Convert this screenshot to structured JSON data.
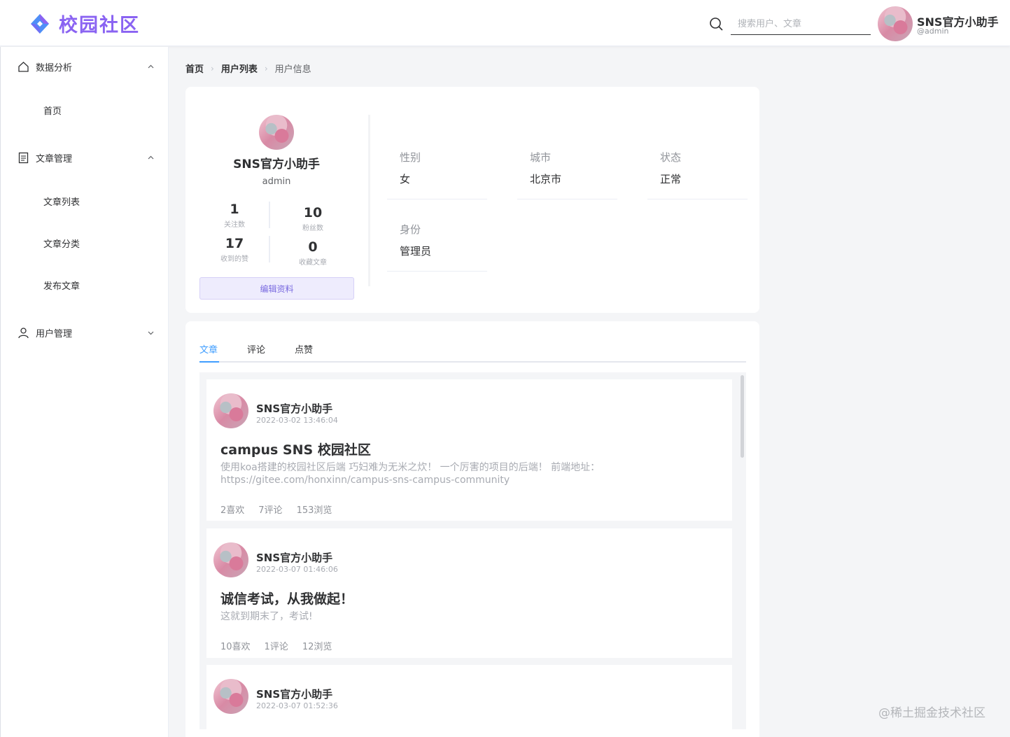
{
  "header": {
    "logo_text": "校园社区",
    "search_placeholder": "搜索用户、文章",
    "user_name": "SNS官方小助手",
    "user_handle": "@admin"
  },
  "sidebar": {
    "groups": [
      {
        "label": "数据分析",
        "icon": "home-icon",
        "expanded": true,
        "items": [
          "首页"
        ]
      },
      {
        "label": "文章管理",
        "icon": "document-icon",
        "expanded": true,
        "items": [
          "文章列表",
          "文章分类",
          "发布文章"
        ]
      },
      {
        "label": "用户管理",
        "icon": "user-icon",
        "expanded": false,
        "items": []
      }
    ]
  },
  "breadcrumb": {
    "home": "首页",
    "user_list": "用户列表",
    "current": "用户信息"
  },
  "profile": {
    "name": "SNS官方小助手",
    "handle": "admin",
    "stats": {
      "following": {
        "value": "1",
        "label": "关注数"
      },
      "fans": {
        "value": "10",
        "label": "粉丝数"
      },
      "likes_received": {
        "value": "17",
        "label": "收到的赞"
      },
      "favorites": {
        "value": "0",
        "label": "收藏文章"
      }
    },
    "edit_label": "编辑资料",
    "info": {
      "gender": {
        "key": "性别",
        "value": "女"
      },
      "city": {
        "key": "城市",
        "value": "北京市"
      },
      "status": {
        "key": "状态",
        "value": "正常"
      },
      "role": {
        "key": "身份",
        "value": "管理员"
      }
    }
  },
  "tabs": {
    "articles": "文章",
    "comments": "评论",
    "likes": "点赞",
    "active": "articles"
  },
  "posts": [
    {
      "author": "SNS官方小助手",
      "time": "2022-03-02 13:46:04",
      "title": "campus SNS 校园社区",
      "excerpt": "使用koa搭建的校园社区后端 巧妇难为无米之炊！ 一个厉害的项目的后端！ 前端地址：https://gitee.com/honxinn/campus-sns-campus-community",
      "likes": "2喜欢",
      "comments": "7评论",
      "views": "153浏览"
    },
    {
      "author": "SNS官方小助手",
      "time": "2022-03-07 01:46:06",
      "title": "诚信考试，从我做起！",
      "excerpt": "这就到期末了，考试!",
      "likes": "10喜欢",
      "comments": "1评论",
      "views": "12浏览"
    },
    {
      "author": "SNS官方小助手",
      "time": "2022-03-07 01:52:36"
    }
  ],
  "watermark": "@稀土掘金技术社区",
  "colors": {
    "brand": "#8a63f2",
    "tab_active": "#409eff",
    "edit_button": "#eeecfd"
  }
}
